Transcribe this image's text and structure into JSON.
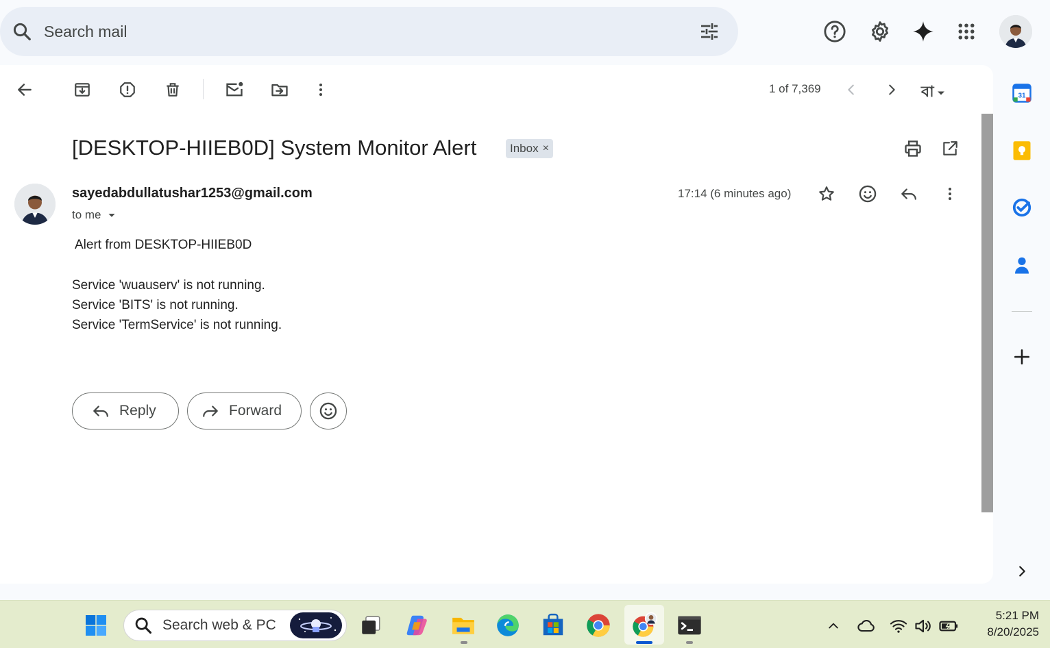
{
  "search": {
    "placeholder": "Search mail"
  },
  "toolbar": {
    "pager": "1 of 7,369",
    "language": "বা"
  },
  "email": {
    "subject": "[DESKTOP-HIIEB0D] System Monitor Alert",
    "label": "Inbox",
    "label_close": "×",
    "sender": "sayedabdullatushar1253@gmail.com",
    "recipient": "to me",
    "time": "17:14 (6 minutes ago)",
    "body": {
      "heading": "Alert from DESKTOP-HIIEB0D",
      "lines": [
        "Service 'wuauserv' is not running.",
        "Service 'BITS' is not running.",
        "Service 'TermService' is not running."
      ]
    }
  },
  "actions": {
    "reply": "Reply",
    "forward": "Forward"
  },
  "side_panel": {
    "calendar_day": "31"
  },
  "taskbar": {
    "search_label": "Search web & PC",
    "time": "5:21 PM",
    "date": "8/20/2025"
  },
  "colors": {
    "accent": "#0b57d0",
    "panel": "#ffffff",
    "background": "#f8fafd",
    "taskbar": "#e4eccd"
  }
}
